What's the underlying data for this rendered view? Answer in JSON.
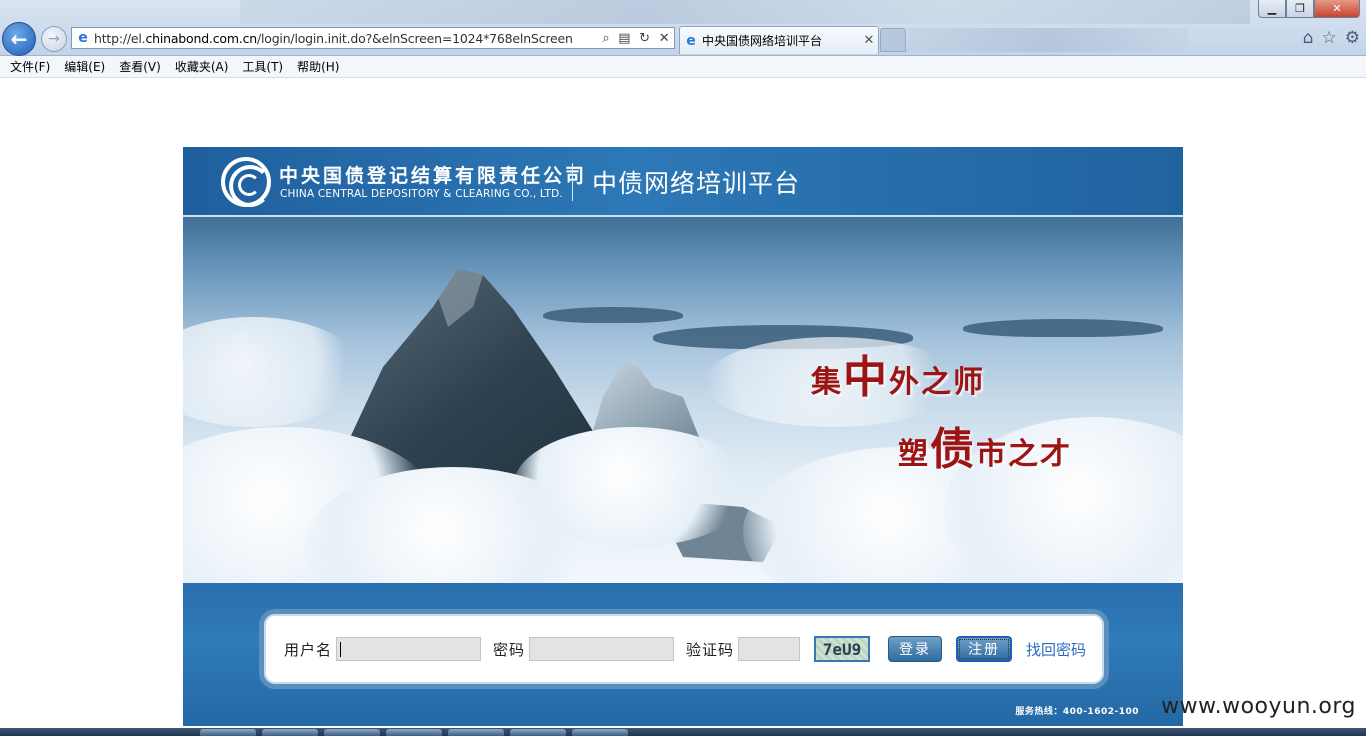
{
  "browser": {
    "address": {
      "url_prefix": "http://el.",
      "url_domain": "chinabond.com.cn",
      "url_rest": "/login/login.init.do?&elnScreen=1024*768elnScreen"
    },
    "tab": {
      "title": "中央国债网络培训平台"
    },
    "menu": [
      "文件(F)",
      "编辑(E)",
      "查看(V)",
      "收藏夹(A)",
      "工具(T)",
      "帮助(H)"
    ]
  },
  "header": {
    "company_cn": "中央国债登记结算有限责任公司",
    "company_en": "CHINA CENTRAL DEPOSITORY & CLEARING CO., LTD.",
    "platform": "中债网络培训平台"
  },
  "slogan": {
    "line1": [
      "集",
      "中",
      "外之师"
    ],
    "line2": [
      "塑",
      "债",
      "市之才"
    ]
  },
  "login": {
    "username_label": "用户名",
    "password_label": "密码",
    "captcha_label": "验证码",
    "captcha_value": "7eU9",
    "login_button": "登录",
    "register_button": "注册",
    "forgot_link": "找回密码",
    "hotline": "服务热线：400-1602-100"
  },
  "watermark": "www.wooyun.org",
  "colors": {
    "header_blue": "#2d78b6",
    "slogan_red": "#9c1414",
    "link_blue": "#2b6cc4"
  }
}
